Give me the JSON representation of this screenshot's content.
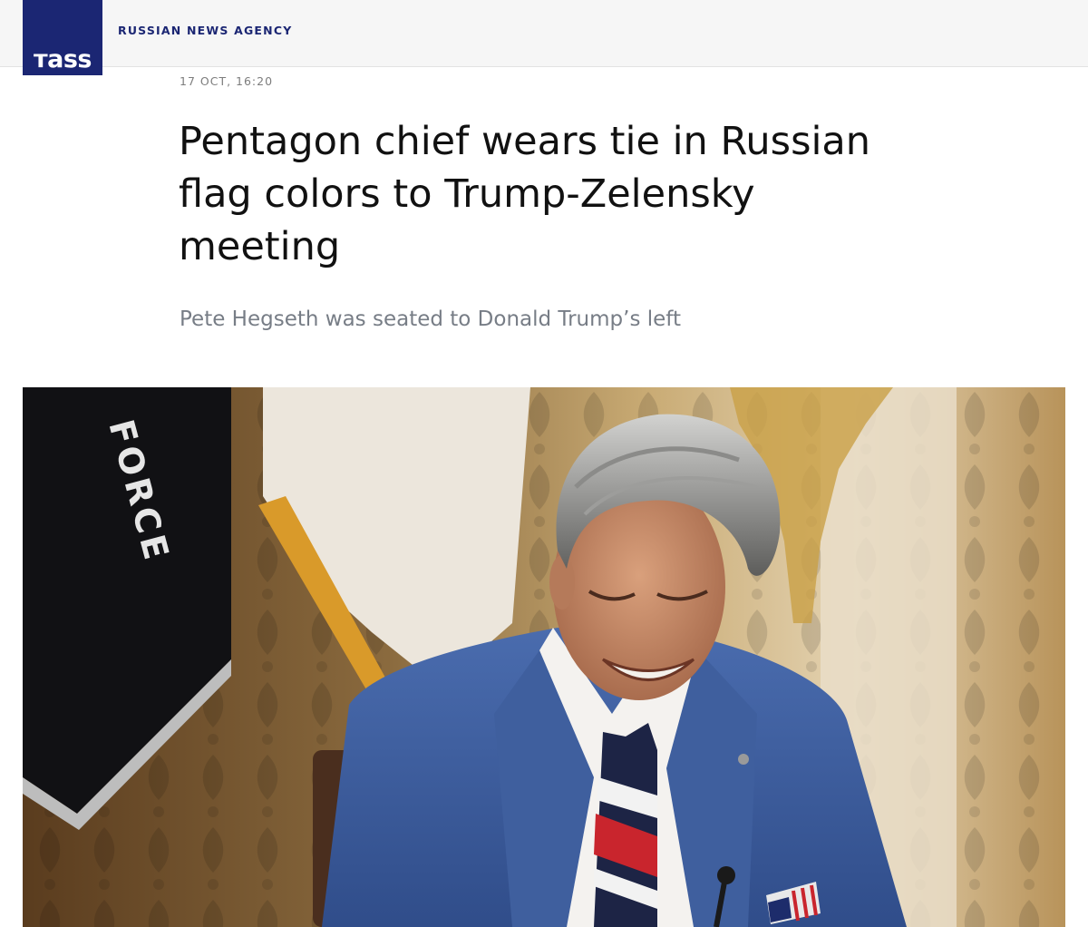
{
  "header": {
    "logo_text": "тass",
    "agency_label": "RUSSIAN NEWS AGENCY",
    "brand_color": "#1b2673"
  },
  "article": {
    "date": "17 OCT, 16:20",
    "headline": "Pentagon chief wears tie in Russian flag colors to Trump-Zelensky meeting",
    "lead": "Pete Hegseth was seated to Donald Trump’s left"
  },
  "photo": {
    "flag_text": "FORCE",
    "subject": "man in blue suit with striped tie smiling"
  }
}
